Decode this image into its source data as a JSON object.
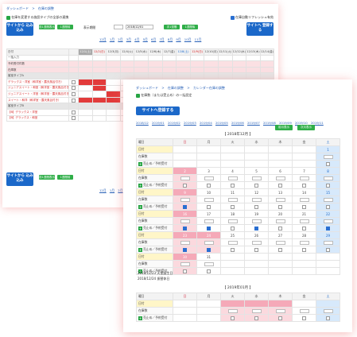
{
  "back": {
    "breadcrumb": [
      "ダッシュボード",
      ">",
      "在庫の調整"
    ],
    "notice": "在庫を変更する施設タイプの全部の連携",
    "notice_right": "在庫自動リフレッシュ有効",
    "btn_left_top": "サイトから 込み込み",
    "btn_right_top": "サイトへ 登録する",
    "btn_left_bottom": "サイトから 込み込み",
    "btn_right_bottom": "サイトへ 登録する",
    "green_a": "前1週間表示",
    "green_b": "1週間前",
    "green_c": "次1週間",
    "green_d": "1週間後",
    "display_label": "表示期間",
    "display_value": "2018/12/01",
    "days_link": [
      "12月",
      "1月",
      "2月",
      "3月",
      "4月",
      "5月",
      "6月",
      "7月",
      "8月",
      "9月",
      "10月",
      "11月"
    ],
    "date_header": [
      "12/1(土)",
      "12/2(日)",
      "12/3(月)",
      "12/4(火)",
      "12/5(水)",
      "12/6(木)",
      "12/7(金)",
      "12/8(土)",
      "12/9(日)",
      "12/10(月)",
      "12/11(火)",
      "12/12(水)",
      "12/13(木)",
      "12/14(金)"
    ],
    "rows": [
      {
        "label": "日付",
        "kind": "plain"
      },
      {
        "label": "一括入力",
        "kind": "plain"
      },
      {
        "label": "予約受付件数",
        "kind": "pink"
      },
      {
        "label": "在庫数",
        "kind": "pink"
      },
      {
        "label": "客室タイプA",
        "kind": "gray"
      },
      {
        "label": "デラックス・洋室（和洋室・露天風呂付き）",
        "kind": "red"
      },
      {
        "label": "ジュニアスイート・和室（和洋室・露天風呂付き）",
        "kind": "red"
      },
      {
        "label": "ジュニアスイート・洋室（和洋室・露天風呂付き）",
        "kind": "red"
      },
      {
        "label": "スイート・和洋（和洋室・露天風呂付き）",
        "kind": "red"
      },
      {
        "label": "客室タイプB",
        "kind": "gray"
      },
      {
        "label": "【B】デラックス・洋室",
        "kind": "red"
      },
      {
        "label": "【B】デラックス・和室",
        "kind": "red"
      }
    ]
  },
  "front": {
    "breadcrumb": [
      "ダッシュボード",
      ">",
      "在庫の調整",
      ">",
      "カレンダー在庫の調整"
    ],
    "notice": "在庫数（または受止め）の一括設定",
    "register_btn": "サイトへ登録する",
    "links": [
      "2018/12",
      "2019/01",
      "2019/02",
      "2019/03",
      "2019/04",
      "2019/05",
      "2019/06",
      "2019/07",
      "2019/08",
      "2019/09",
      "2019/10",
      "2019/11"
    ],
    "prev_month": "前月表示",
    "next_month": "次月表示",
    "month_title": "【 2018年12月 】",
    "month_title2": "【 2019年01月 】",
    "weekday_label": "曜日",
    "weekdays": [
      "日",
      "月",
      "火",
      "水",
      "木",
      "金",
      "土"
    ],
    "day_label": "日付",
    "stock_label": "在庫数",
    "stop_label": "売止め／予約受付",
    "weeks": [
      [
        "",
        "",
        "",
        "",
        "",
        "",
        "1"
      ],
      [
        "2",
        "3",
        "4",
        "5",
        "6",
        "7",
        "8"
      ],
      [
        "9",
        "10",
        "11",
        "12",
        "13",
        "14",
        "15"
      ],
      [
        "16",
        "17",
        "18",
        "19",
        "20",
        "21",
        "22"
      ],
      [
        "23",
        "24",
        "25",
        "26",
        "27",
        "28",
        "29"
      ],
      [
        "30",
        "31",
        "",
        "",
        "",
        "",
        ""
      ]
    ],
    "holiday_notes": [
      "2018/12/23 天皇誕生日",
      "2018/12/24 振替休日"
    ]
  }
}
